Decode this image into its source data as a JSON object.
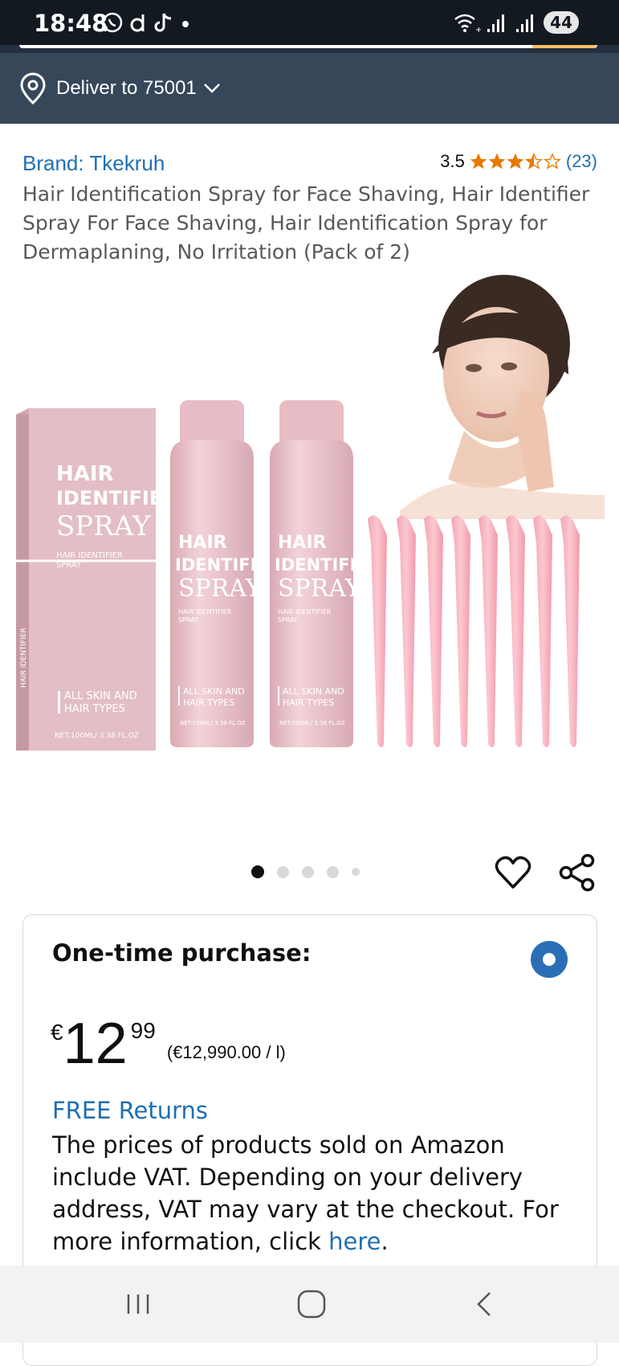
{
  "status_bar": {
    "time": "18:48",
    "left_icons": [
      "whatsapp-icon",
      "d-app-icon",
      "tiktok-icon",
      "dot-icon"
    ],
    "battery": "44"
  },
  "deliver": {
    "label": "Deliver to 75001"
  },
  "product": {
    "brand": "Brand: Tkekruh",
    "rating_value": "3.5",
    "rating_stars": 3.5,
    "rating_count": "(23)",
    "title": "Hair Identification Spray for Face Shaving, Hair Identifier Spray For Face Shaving, Hair Identification Spray for Dermaplaning, No Irritation (Pack of 2)",
    "image": {
      "box_line1": "HAIR",
      "box_line2": "IDENTIFIER",
      "box_line3": "SPRAY",
      "box_sub": "HAIR IDENTIFIER",
      "box_sub2": "SPRAY",
      "box_skin1": "ALL SKIN AND",
      "box_skin2": "HAIR TYPES",
      "box_net": "NET:100ML/ 3.38 FL.OZ",
      "can_line1": "HAIR",
      "can_line2": "IDENTIFIER",
      "can_line3": "SPRAY",
      "can_sub": "HAIR IDENTIFIER",
      "can_sub2": "SPRAY",
      "can_skin1": "ALL SKIN AND",
      "can_skin2": "HAIR TYPES",
      "can_net": "NET:100ML/ 3.38 FL.OZ",
      "box_side": "HAIR IDENTIFIER"
    }
  },
  "carousel": {
    "total": 5,
    "active_index": 0
  },
  "purchase": {
    "option_label": "One-time purchase:",
    "price_symbol": "€",
    "price_whole": "12",
    "price_fraction": "99",
    "price_per_unit": "(€12,990.00 / l)",
    "free_returns": "FREE Returns",
    "vat_text": "The prices of products sold on Amazon include VAT. Depending on your delivery address, VAT may vary at the checkout. For more information, click ",
    "vat_link": "here",
    "vat_end": "."
  },
  "nav_bar": {
    "buttons": [
      "recent-apps-icon",
      "home-icon",
      "back-icon"
    ]
  },
  "colors": {
    "top_bar": "#131921",
    "deliver_bar": "#37475a",
    "link": "#1f6fb3",
    "star": "#e67a00",
    "product_pink": "#e8bfc6",
    "radio": "#2a6eb5"
  }
}
